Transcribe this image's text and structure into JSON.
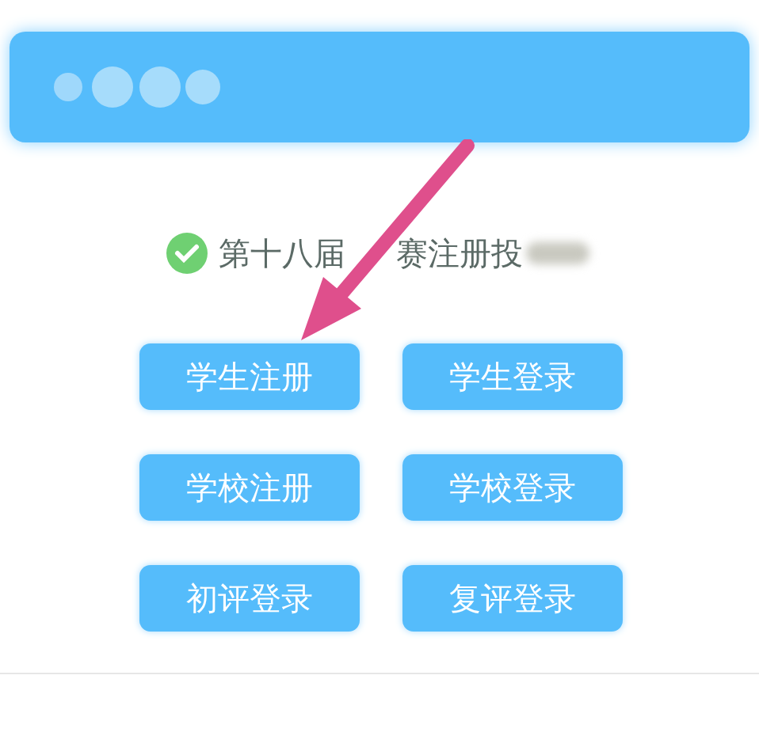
{
  "notice": {
    "texts": [
      "第十八届",
      "赛注册投"
    ]
  },
  "buttons": [
    {
      "label": "学生注册"
    },
    {
      "label": "学生登录"
    },
    {
      "label": "学校注册"
    },
    {
      "label": "学校登录"
    },
    {
      "label": "初评登录"
    },
    {
      "label": "复评登录"
    }
  ]
}
